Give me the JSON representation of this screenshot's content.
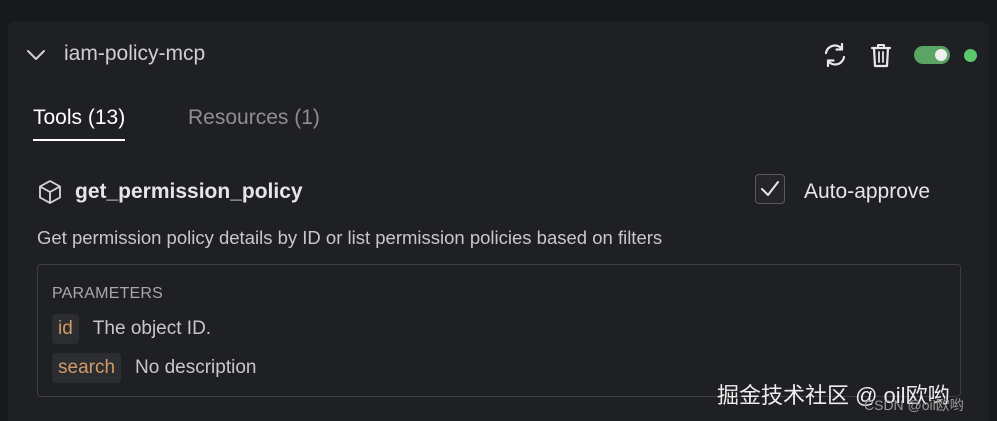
{
  "server": {
    "name": "iam-policy-mcp",
    "enabled": true,
    "status": "connected",
    "status_color": "#5ac96d",
    "toggle_color": "#5aa464"
  },
  "tabs": [
    {
      "label": "Tools (13)",
      "active": true
    },
    {
      "label": "Resources (1)",
      "active": false
    }
  ],
  "tool": {
    "icon": "cube-icon",
    "name": "get_permission_policy",
    "auto_approve_label": "Auto-approve",
    "auto_approve_checked": true,
    "description": "Get permission policy details by ID or list permission policies based on filters"
  },
  "parameters": {
    "title": "PARAMETERS",
    "items": [
      {
        "name": "id",
        "description": "The object ID."
      },
      {
        "name": "search",
        "description": "No description"
      }
    ]
  },
  "watermarks": {
    "juejin": "掘金技术社区 @ oil欧哟",
    "csdn": "CSDN @oil欧哟"
  },
  "accent_colors": {
    "param_name": "#d19a66",
    "background": "#18191c",
    "panel": "#1f2023"
  }
}
